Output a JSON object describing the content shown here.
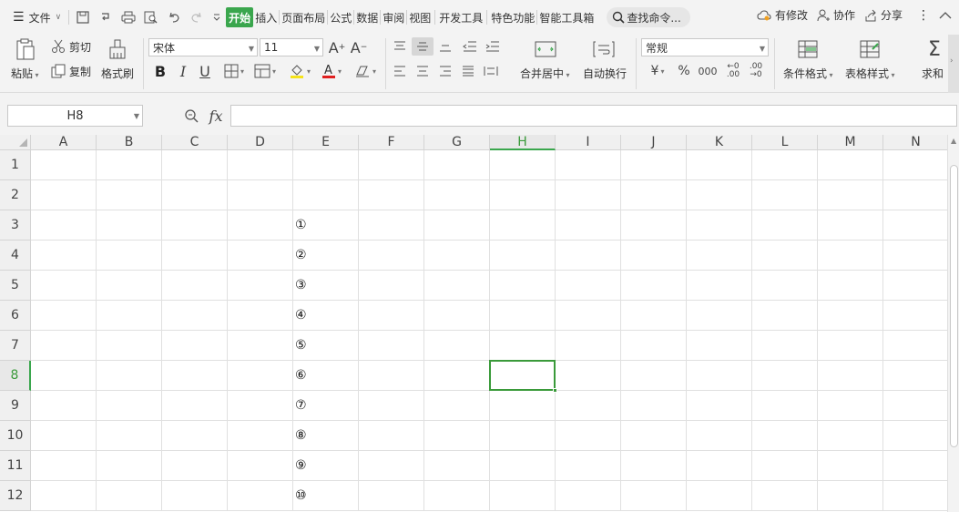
{
  "menubar": {
    "file": "文件",
    "tabs": [
      "开始",
      "插入",
      "页面布局",
      "公式",
      "数据",
      "审阅",
      "视图",
      "开发工具",
      "特色功能",
      "智能工具箱"
    ],
    "active_tab": "开始",
    "search": "查找命令...",
    "has_changes": "有修改",
    "collaborate": "协作",
    "share": "分享"
  },
  "ribbon": {
    "paste": "粘贴",
    "cut": "剪切",
    "copy": "复制",
    "format_painter": "格式刷",
    "font_name": "宋体",
    "font_size": "11",
    "bold": "B",
    "italic": "I",
    "underline": "U",
    "merge_center": "合并居中",
    "wrap_text": "自动换行",
    "number_format": "常规",
    "currency": "¥",
    "percent": "%",
    "thousands": "000",
    "dec_increase": ".00",
    "dec_decrease": ".00",
    "conditional_format": "条件格式",
    "table_style": "表格样式",
    "sum": "求和"
  },
  "formula_bar": {
    "name_box": "H8",
    "fx": "fx",
    "value": ""
  },
  "grid": {
    "columns": [
      "A",
      "B",
      "C",
      "D",
      "E",
      "F",
      "G",
      "H",
      "I",
      "J",
      "K",
      "L",
      "M",
      "N"
    ],
    "rows": [
      "1",
      "2",
      "3",
      "4",
      "5",
      "6",
      "7",
      "8",
      "9",
      "10",
      "11",
      "12"
    ],
    "selected_col": "H",
    "selected_row": "8",
    "cells_E": [
      "",
      "",
      "①",
      "②",
      "③",
      "④",
      "⑤",
      "⑥",
      "⑦",
      "⑧",
      "⑨",
      "⑩"
    ]
  },
  "colors": {
    "accent": "#3aa64d",
    "selection": "#3a9a3a"
  }
}
